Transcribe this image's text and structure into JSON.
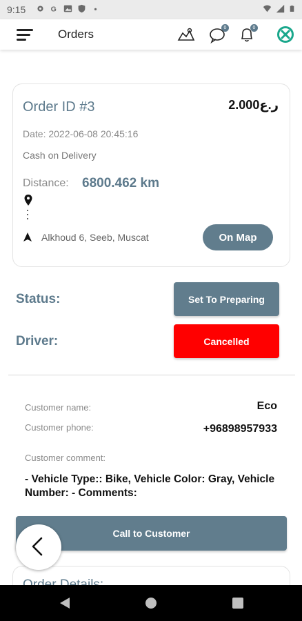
{
  "status_bar": {
    "time": "9:15",
    "left_icons": [
      "settings-icon",
      "google-icon",
      "gallery-icon",
      "shield-icon",
      "dot-icon"
    ],
    "right_icons": [
      "wifi-icon",
      "signal-icon",
      "battery-icon"
    ]
  },
  "app_bar": {
    "title": "Orders",
    "chat_badge": "0",
    "notification_badge": "0",
    "accent": "#5d7a8c",
    "logo_color": "#1aa78c"
  },
  "order": {
    "id_label": "Order ID #3",
    "price": "2.000ر.ع",
    "date": "Date: 2022-06-08 20:45:16",
    "payment_method": "Cash on Delivery",
    "distance_label": "Distance:",
    "distance_value": "6800.462 km",
    "address": "Alkhoud 6, Seeb, Muscat",
    "on_map_label": "On Map"
  },
  "status": {
    "label": "Status:",
    "button_label": "Set To Preparing"
  },
  "driver": {
    "label": "Driver:",
    "button_label": "Cancelled",
    "button_color": "#ff0000"
  },
  "customer": {
    "name_label": "Customer name:",
    "name_value": "Eco",
    "phone_label": "Customer phone:",
    "phone_value": "+96898957933",
    "comment_label": "Customer comment:",
    "comment_value": "- Vehicle Type:: Bike, Vehicle Color: Gray, Vehicle Number:  - Comments:"
  },
  "call_button_label": "Call to Customer",
  "order_details_title": "Order Details:"
}
